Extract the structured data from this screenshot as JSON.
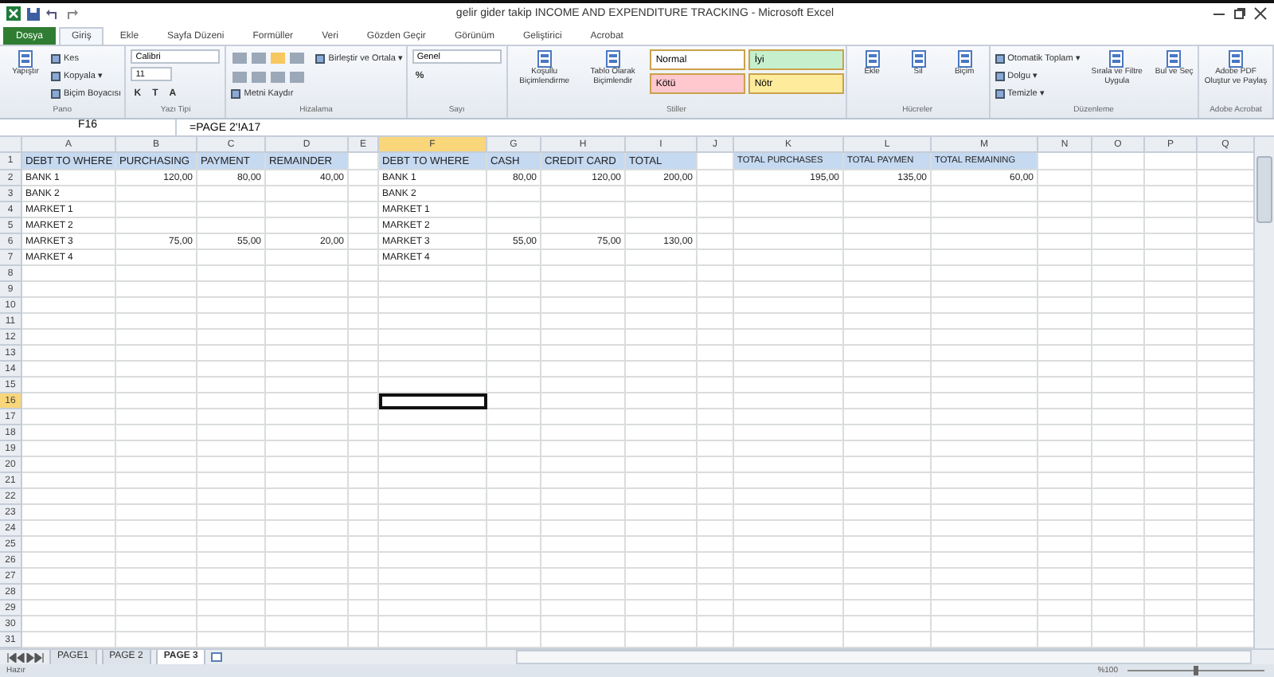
{
  "window": {
    "title": "gelir gider takip INCOME AND EXPENDITURE TRACKING  -  Microsoft Excel"
  },
  "tabs": [
    {
      "label": "Dosya",
      "selected": false,
      "kind": "file"
    },
    {
      "label": "Giriş",
      "selected": true,
      "kind": "tab"
    },
    {
      "label": "Ekle",
      "selected": false,
      "kind": "tab"
    },
    {
      "label": "Sayfa Düzeni",
      "selected": false,
      "kind": "tab"
    },
    {
      "label": "Formüller",
      "selected": false,
      "kind": "tab"
    },
    {
      "label": "Veri",
      "selected": false,
      "kind": "tab"
    },
    {
      "label": "Gözden Geçir",
      "selected": false,
      "kind": "tab"
    },
    {
      "label": "Görünüm",
      "selected": false,
      "kind": "tab"
    },
    {
      "label": "Geliştirici",
      "selected": false,
      "kind": "tab"
    },
    {
      "label": "Acrobat",
      "selected": false,
      "kind": "tab"
    }
  ],
  "ribbon": [
    {
      "label": "Pano",
      "items": [
        {
          "kind": "large",
          "text": "Yapıştır"
        },
        {
          "kind": "small",
          "text": "Kes"
        },
        {
          "kind": "small",
          "text": "Kopyala ▾"
        },
        {
          "kind": "small",
          "text": "Biçim Boyacısı"
        }
      ]
    },
    {
      "label": "Yazı Tipi",
      "items": [
        {
          "kind": "combo",
          "text": "Calibri"
        },
        {
          "kind": "combo",
          "text": "11"
        },
        {
          "kind": "format",
          "texts": [
            "K",
            "T",
            "A"
          ]
        }
      ]
    },
    {
      "label": "Hizalama",
      "items": [
        {
          "kind": "align"
        },
        {
          "kind": "small",
          "text": "Metni Kaydır"
        },
        {
          "kind": "small",
          "text": "Birleştir ve Ortala ▾"
        }
      ]
    },
    {
      "label": "Sayı",
      "items": [
        {
          "kind": "combo",
          "text": "Genel"
        },
        {
          "kind": "format",
          "texts": [
            "%"
          ]
        }
      ]
    },
    {
      "label": "Stiller",
      "items": [
        {
          "kind": "large",
          "text": "Koşullu Biçimlendirme"
        },
        {
          "kind": "large",
          "text": "Tablo Olarak Biçimlendir"
        },
        {
          "kind": "styles",
          "styles": [
            {
              "text": "Normal",
              "color": "#ffffff"
            },
            {
              "text": "İyi",
              "color": "#c6efce"
            },
            {
              "text": "Kötü",
              "color": "#ffc7ce"
            },
            {
              "text": "Nötr",
              "color": "#ffeb9c"
            }
          ]
        }
      ]
    },
    {
      "label": "Hücreler",
      "items": [
        {
          "kind": "large",
          "text": "Ekle"
        },
        {
          "kind": "large",
          "text": "Sil"
        },
        {
          "kind": "large",
          "text": "Biçim"
        }
      ]
    },
    {
      "label": "Düzenleme",
      "items": [
        {
          "kind": "small",
          "text": "Otomatik Toplam ▾"
        },
        {
          "kind": "small",
          "text": "Dolgu ▾"
        },
        {
          "kind": "small",
          "text": "Temizle ▾"
        },
        {
          "kind": "large",
          "text": "Sırala ve Filtre Uygula"
        },
        {
          "kind": "large",
          "text": "Bul ve Seç"
        }
      ]
    },
    {
      "label": "Adobe Acrobat",
      "items": [
        {
          "kind": "large",
          "text": "Adobe PDF Oluştur ve Paylaş"
        }
      ]
    }
  ],
  "formula_bar": {
    "name_box": "F16",
    "formula": "=PAGE 2'!A17"
  },
  "sheet": {
    "columns": [
      {
        "label": "A",
        "selected": false
      },
      {
        "label": "B",
        "selected": false
      },
      {
        "label": "C",
        "selected": false
      },
      {
        "label": "D",
        "selected": false
      },
      {
        "label": "E",
        "selected": false
      },
      {
        "label": "F",
        "selected": true
      },
      {
        "label": "G",
        "selected": false
      },
      {
        "label": "H",
        "selected": false
      },
      {
        "label": "I",
        "selected": false
      },
      {
        "label": "J",
        "selected": false
      },
      {
        "label": "K",
        "selected": false
      },
      {
        "label": "L",
        "selected": false
      },
      {
        "label": "M",
        "selected": false
      },
      {
        "label": "N",
        "selected": false
      },
      {
        "label": "O",
        "selected": false
      },
      {
        "label": "P",
        "selected": false
      },
      {
        "label": "Q",
        "selected": false
      }
    ],
    "rows": [
      {
        "label": "1",
        "selected": false
      },
      {
        "label": "2",
        "selected": false
      },
      {
        "label": "3",
        "selected": false
      },
      {
        "label": "4",
        "selected": false
      },
      {
        "label": "5",
        "selected": false
      },
      {
        "label": "6",
        "selected": false
      },
      {
        "label": "7",
        "selected": false
      },
      {
        "label": "8",
        "selected": false
      },
      {
        "label": "9",
        "selected": false
      },
      {
        "label": "10",
        "selected": false
      },
      {
        "label": "11",
        "selected": false
      },
      {
        "label": "12",
        "selected": false
      },
      {
        "label": "13",
        "selected": false
      },
      {
        "label": "14",
        "selected": false
      },
      {
        "label": "15",
        "selected": false
      },
      {
        "label": "16",
        "selected": true
      },
      {
        "label": "17",
        "selected": false
      },
      {
        "label": "18",
        "selected": false
      },
      {
        "label": "19",
        "selected": false
      },
      {
        "label": "20",
        "selected": false
      },
      {
        "label": "21",
        "selected": false
      },
      {
        "label": "22",
        "selected": false
      },
      {
        "label": "23",
        "selected": false
      },
      {
        "label": "24",
        "selected": false
      },
      {
        "label": "25",
        "selected": false
      },
      {
        "label": "26",
        "selected": false
      },
      {
        "label": "27",
        "selected": false
      },
      {
        "label": "28",
        "selected": false
      },
      {
        "label": "29",
        "selected": false
      },
      {
        "label": "30",
        "selected": false
      },
      {
        "label": "31",
        "selected": false
      }
    ],
    "tables": [
      {
        "columns": [
          "DEBT TO WHERE",
          "PURCHASING",
          "PAYMENT",
          "REMAINDER"
        ],
        "rows": [
          [
            "BANK 1",
            "120,00",
            "80,00",
            "40,00"
          ],
          [
            "BANK 2"
          ],
          [
            "MARKET 1"
          ],
          [
            "MARKET 2"
          ],
          [
            "MARKET 3",
            "75,00",
            "55,00",
            "20,00"
          ],
          [
            "MARKET 4"
          ]
        ]
      },
      {
        "columns": [
          "DEBT TO WHERE",
          "CASH",
          "CREDIT CARD",
          "TOTAL"
        ],
        "rows": [
          [
            "BANK 1",
            "80,00",
            "120,00",
            "200,00"
          ],
          [
            "BANK 2"
          ],
          [
            "MARKET 1"
          ],
          [
            "MARKET 2"
          ],
          [
            "MARKET 3",
            "55,00",
            "75,00",
            "130,00"
          ],
          [
            "MARKET 4"
          ]
        ]
      },
      {
        "columns": [
          "TOTAL PURCHASES",
          "TOTAL PAYMEN",
          "TOTAL REMAINING"
        ],
        "rows": [
          [
            "195,00",
            "135,00",
            "60,00"
          ]
        ]
      }
    ]
  },
  "sheet_tabs": [
    {
      "label": "PAGE1",
      "selected": false
    },
    {
      "label": "PAGE 2",
      "selected": false
    },
    {
      "label": "PAGE 3",
      "selected": true
    }
  ],
  "status_bar": {
    "mode": "Hazır",
    "zoom": "%100",
    "zoom_slider": {
      "level": 0.5
    }
  }
}
